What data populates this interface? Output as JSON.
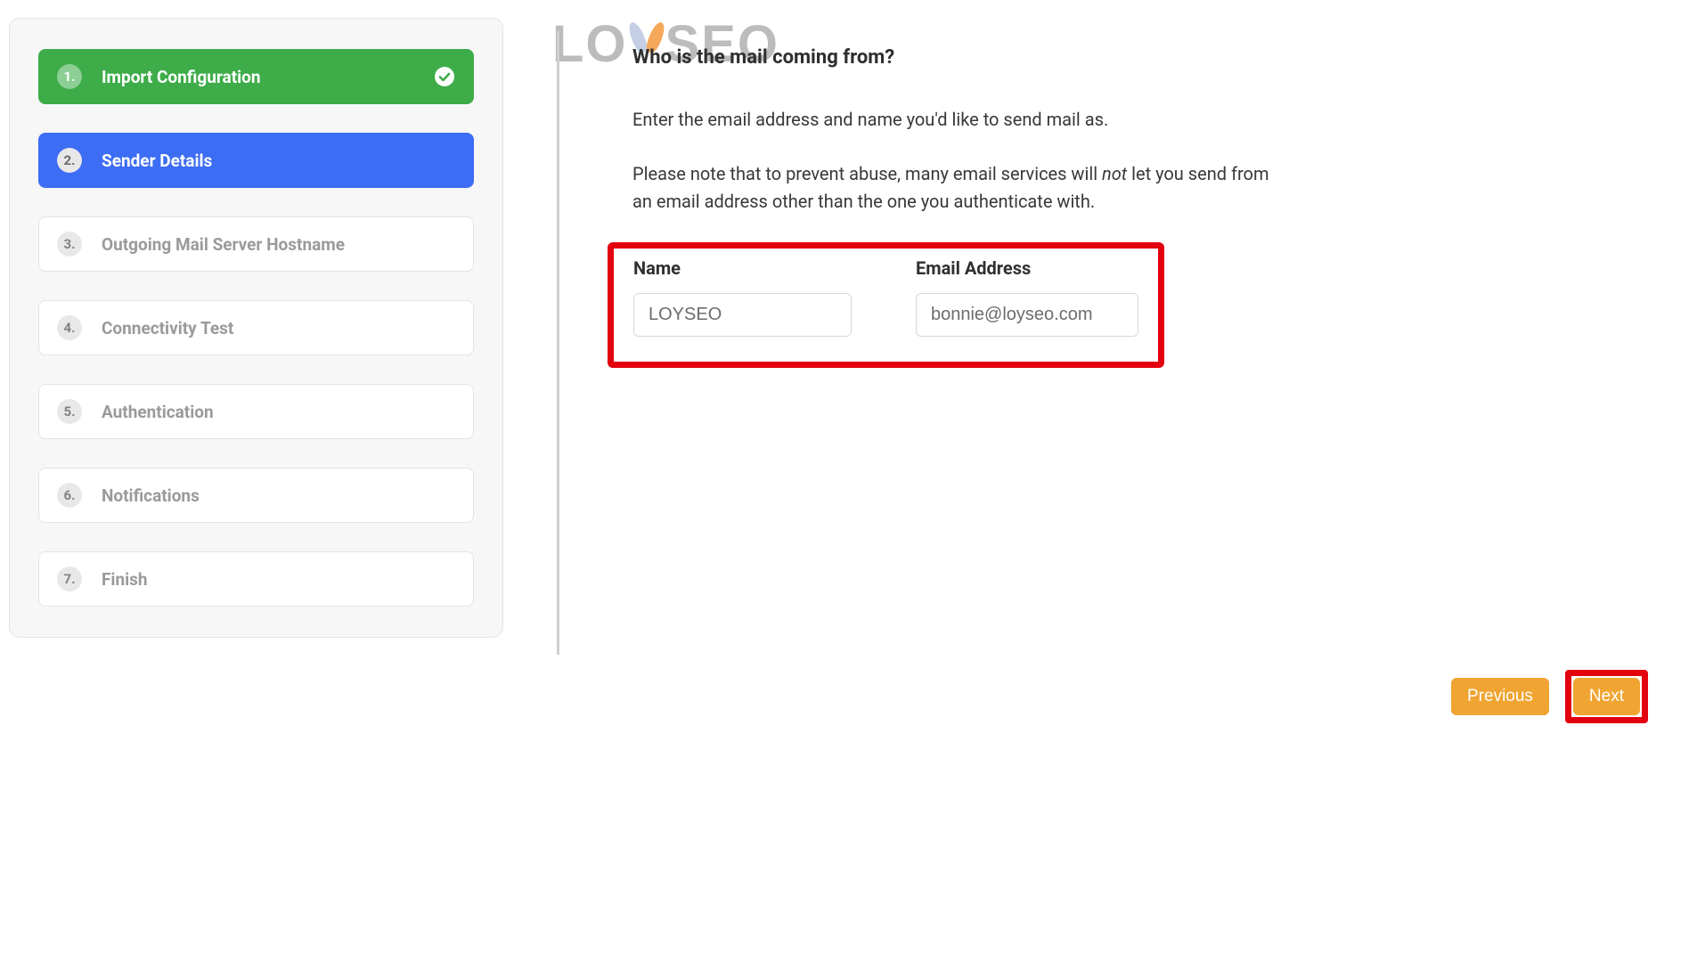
{
  "watermark": "LOYSEO",
  "sidebar": {
    "steps": [
      {
        "num": "1.",
        "label": "Import Configuration",
        "state": "completed"
      },
      {
        "num": "2.",
        "label": "Sender Details",
        "state": "active"
      },
      {
        "num": "3.",
        "label": "Outgoing Mail Server Hostname",
        "state": ""
      },
      {
        "num": "4.",
        "label": "Connectivity Test",
        "state": ""
      },
      {
        "num": "5.",
        "label": "Authentication",
        "state": ""
      },
      {
        "num": "6.",
        "label": "Notifications",
        "state": ""
      },
      {
        "num": "7.",
        "label": "Finish",
        "state": ""
      }
    ]
  },
  "content": {
    "heading": "Who is the mail coming from?",
    "para1": "Enter the email address and name you'd like to send mail as.",
    "para2_a": "Please note that to prevent abuse, many email services will ",
    "para2_em": "not",
    "para2_b": " let you send from an email address other than the one you authenticate with."
  },
  "form": {
    "name_label": "Name",
    "name_value": "LOYSEO",
    "email_label": "Email Address",
    "email_value": "bonnie@loyseo.com"
  },
  "buttons": {
    "previous": "Previous",
    "next": "Next"
  }
}
